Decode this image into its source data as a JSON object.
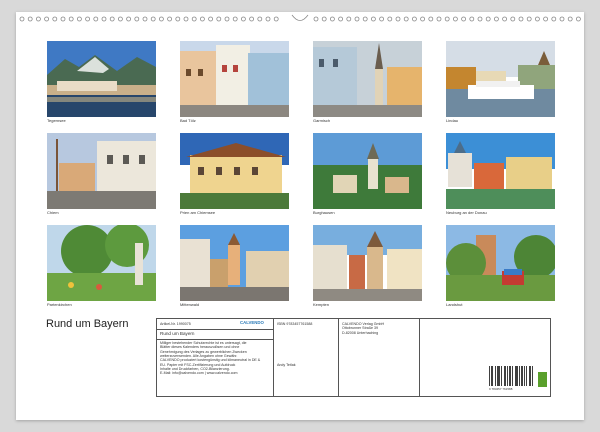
{
  "calendar_title": "Rund um Bayern",
  "photos": [
    {
      "caption": "Tegernsee"
    },
    {
      "caption": "Bad Tölz"
    },
    {
      "caption": "Garmisch"
    },
    {
      "caption": "Lindau"
    },
    {
      "caption": "Chiem"
    },
    {
      "caption": "Prien am Chiemsee"
    },
    {
      "caption": "Burghausen"
    },
    {
      "caption": "Neuburg an der Donau"
    },
    {
      "caption": "Partenkirchen"
    },
    {
      "caption": "Mittenwald"
    },
    {
      "caption": "Kempten"
    },
    {
      "caption": "Landshut"
    }
  ],
  "info": {
    "article_no": "Artikel-Nr. 1990075",
    "calvendo_logo": "CALVENDO",
    "title": "Rund um Bayern",
    "description": [
      "Milliger bestehender Schutzrechte ist es untersagt, die",
      "Blätter dieses Kalenders herauszulösen und ohne",
      "Genehmigung des Verlages zu gewerblichen Zwecken",
      "weiterzuverwenden. Alle Angaben ohne Gewähr.",
      "CALVENDO produziert kostengünstig und klimaneutral in DE &",
      "EU. Papier mit FSC-Zertifizierung und Aufdruck",
      "Inhalte und Druckfarben, CO2-Bilanzierung.",
      "E-Mail: info@calvendo.com | www.calvendo.com"
    ],
    "isbn": "ISBN 9783457761588",
    "author": "Andy Tetlak",
    "publisher": [
      "CALVENDO Verlag GmbH",
      "Ottobrunner Straße 39",
      "D-82008 Unterhaching"
    ],
    "barcode_number": "9 783457 761588"
  }
}
